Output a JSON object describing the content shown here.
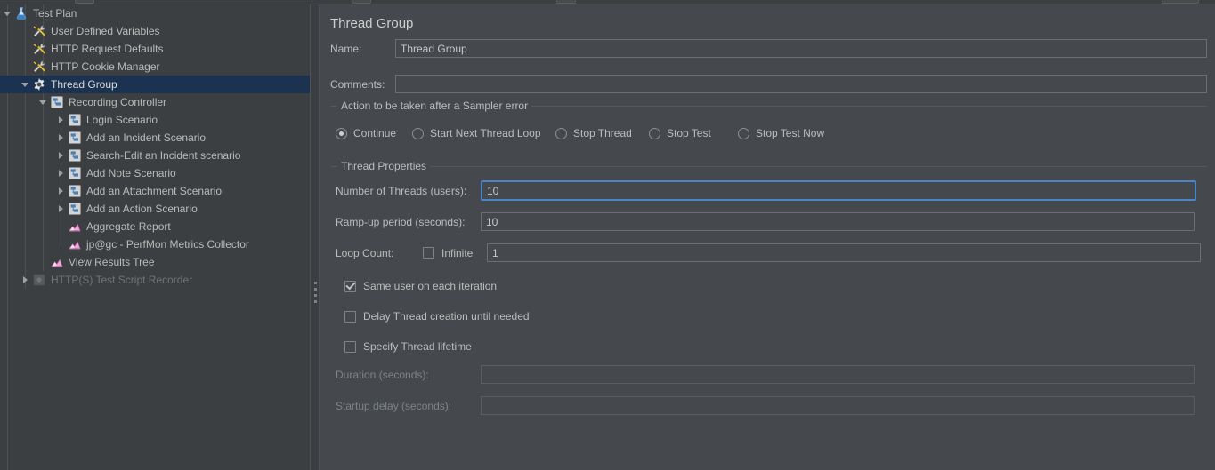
{
  "theme": {
    "panel_bg": "#45494d",
    "tree_bg": "#3c3f41",
    "selection_bg": "#1b3350",
    "text": "#bcbcbc",
    "disabled_text": "#7e8387",
    "focus_border": "#4a86c6",
    "listener_icon": "#f0a8d8",
    "controller_icon": "#4a7fb5"
  },
  "tree": {
    "items": [
      {
        "label": "Test Plan",
        "depth": 0,
        "icon": "test-plan-icon",
        "toggle": "down",
        "selected": false,
        "disabled": false
      },
      {
        "label": "User Defined Variables",
        "depth": 1,
        "icon": "config-element-icon",
        "toggle": "none",
        "selected": false,
        "disabled": false
      },
      {
        "label": "HTTP Request Defaults",
        "depth": 1,
        "icon": "config-element-icon",
        "toggle": "none",
        "selected": false,
        "disabled": false
      },
      {
        "label": "HTTP Cookie Manager",
        "depth": 1,
        "icon": "config-element-icon",
        "toggle": "none",
        "selected": false,
        "disabled": false
      },
      {
        "label": "Thread Group",
        "depth": 1,
        "icon": "thread-group-icon",
        "toggle": "down",
        "selected": true,
        "disabled": false
      },
      {
        "label": "Recording Controller",
        "depth": 2,
        "icon": "controller-icon",
        "toggle": "down",
        "selected": false,
        "disabled": false
      },
      {
        "label": "Login Scenario",
        "depth": 3,
        "icon": "controller-icon",
        "toggle": "right",
        "selected": false,
        "disabled": false
      },
      {
        "label": "Add an Incident Scenario",
        "depth": 3,
        "icon": "controller-icon",
        "toggle": "right",
        "selected": false,
        "disabled": false
      },
      {
        "label": "Search-Edit an Incident scenario",
        "depth": 3,
        "icon": "controller-icon",
        "toggle": "right",
        "selected": false,
        "disabled": false
      },
      {
        "label": "Add Note Scenario",
        "depth": 3,
        "icon": "controller-icon",
        "toggle": "right",
        "selected": false,
        "disabled": false
      },
      {
        "label": "Add an Attachment Scenario",
        "depth": 3,
        "icon": "controller-icon",
        "toggle": "right",
        "selected": false,
        "disabled": false
      },
      {
        "label": "Add an Action Scenario",
        "depth": 3,
        "icon": "controller-icon",
        "toggle": "right",
        "selected": false,
        "disabled": false
      },
      {
        "label": "Aggregate Report",
        "depth": 3,
        "icon": "listener-icon",
        "toggle": "none",
        "selected": false,
        "disabled": false
      },
      {
        "label": "jp@gc - PerfMon Metrics Collector",
        "depth": 3,
        "icon": "listener-icon",
        "toggle": "none",
        "selected": false,
        "disabled": false
      },
      {
        "label": "View Results Tree",
        "depth": 2,
        "icon": "listener-icon",
        "toggle": "none",
        "selected": false,
        "disabled": false
      },
      {
        "label": "HTTP(S) Test Script Recorder",
        "depth": 1,
        "icon": "recorder-icon",
        "toggle": "right",
        "selected": false,
        "disabled": true
      }
    ]
  },
  "panel": {
    "title": "Thread Group",
    "name_label": "Name:",
    "name_value": "Thread Group",
    "name_placeholder": "",
    "comments_label": "Comments:",
    "comments_value": "",
    "comments_placeholder": "",
    "sampler_error_group_title": "Action to be taken after a Sampler error",
    "sampler_error_options": [
      {
        "label": "Continue",
        "selected": true
      },
      {
        "label": "Start Next Thread Loop",
        "selected": false
      },
      {
        "label": "Stop Thread",
        "selected": false
      },
      {
        "label": "Stop Test",
        "selected": false
      },
      {
        "label": "Stop Test Now",
        "selected": false
      }
    ],
    "thread_properties_group_title": "Thread Properties",
    "num_threads_label": "Number of Threads (users):",
    "num_threads_value": "10",
    "rampup_label": "Ramp-up period (seconds):",
    "rampup_value": "10",
    "loop_count_label": "Loop Count:",
    "infinite_label": "Infinite",
    "infinite_checked": false,
    "loop_count_value": "1",
    "same_user_label": "Same user on each iteration",
    "same_user_checked": true,
    "delay_thread_label": "Delay Thread creation until needed",
    "delay_thread_checked": false,
    "specify_lifetime_label": "Specify Thread lifetime",
    "specify_lifetime_checked": false,
    "duration_label": "Duration (seconds):",
    "duration_value": "",
    "duration_disabled": true,
    "startup_delay_label": "Startup delay (seconds):",
    "startup_delay_value": "",
    "startup_delay_disabled": true
  }
}
